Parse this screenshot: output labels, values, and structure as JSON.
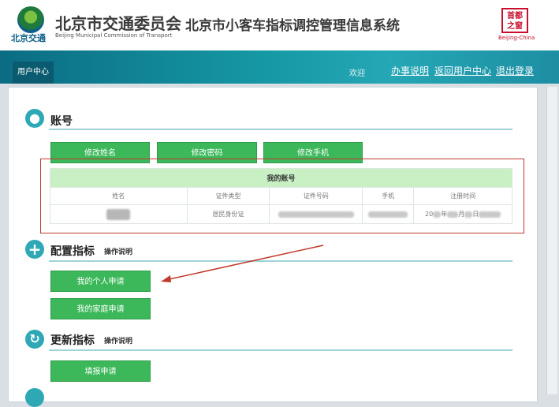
{
  "header": {
    "org_logo_text": "北京交通",
    "org_name": "北京市交通委员会",
    "org_name_en": "Beijing Municipal Commission of Transport",
    "system_name": "北京市小客车指标调控管理信息系统",
    "seal_text": "首都之窗",
    "seal_en": "Beijing-China"
  },
  "nav": {
    "tab_label": "用户中心",
    "welcome": "欢迎",
    "links": [
      "办事说明",
      "返回用户中心",
      "退出登录"
    ]
  },
  "account": {
    "title": "账号",
    "buttons": [
      "修改姓名",
      "修改密码",
      "修改手机"
    ],
    "table_caption": "我的账号",
    "columns": [
      "姓名",
      "证件类型",
      "证件号码",
      "手机",
      "注册时间"
    ],
    "row": {
      "id_type": "居民身份证",
      "reg_time_prefix": "20",
      "reg_time_mid1": "年",
      "reg_time_mid2": "月",
      "reg_time_mid3": "日"
    }
  },
  "quota": {
    "title": "配置指标",
    "help": "操作说明",
    "buttons": [
      "我的个人申请",
      "我的家庭申请"
    ]
  },
  "renew": {
    "title": "更新指标",
    "help": "操作说明",
    "buttons": [
      "填报申请"
    ]
  },
  "colors": {
    "accent": "#2fa8b6",
    "button": "#3cb85a",
    "highlight": "#c0392b"
  }
}
